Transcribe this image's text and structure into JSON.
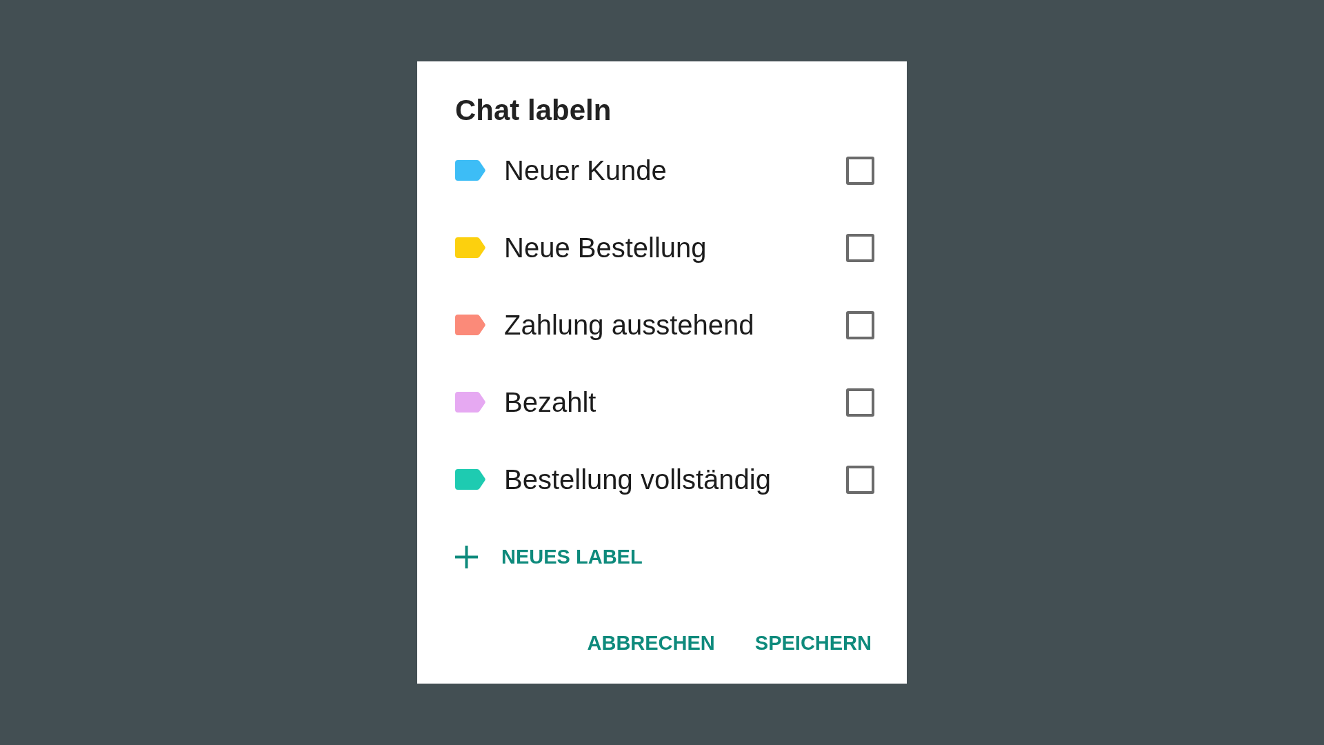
{
  "dialog": {
    "title": "Chat labeln",
    "labels": [
      {
        "name": "Neuer Kunde",
        "color": "#3dbdf6",
        "checked": false
      },
      {
        "name": "Neue Bestellung",
        "color": "#fcd00e",
        "checked": false
      },
      {
        "name": "Zahlung ausstehend",
        "color": "#fb8a79",
        "checked": false
      },
      {
        "name": "Bezahlt",
        "color": "#e6a9f2",
        "checked": false
      },
      {
        "name": "Bestellung vollständig",
        "color": "#1ecbb1",
        "checked": false
      }
    ],
    "new_label_button": "NEUES LABEL",
    "buttons": [
      "ABBRECHEN",
      "SPEICHERN"
    ]
  }
}
